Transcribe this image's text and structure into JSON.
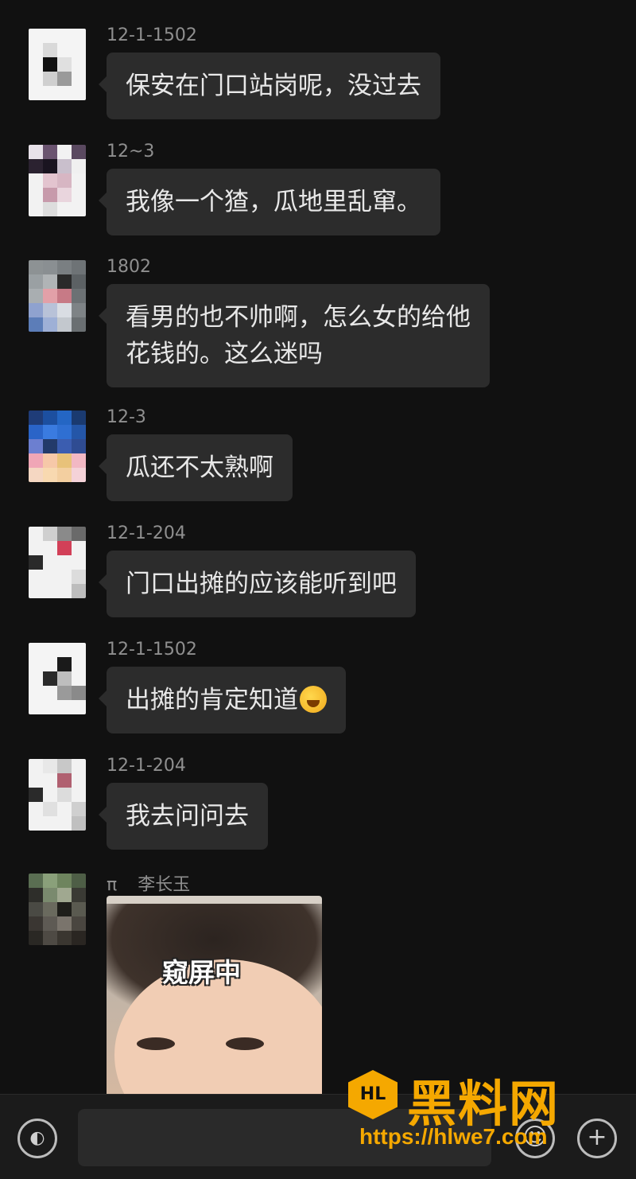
{
  "messages": [
    {
      "sender": "12-1-1502",
      "lines": [
        "保安在门口站岗呢，没过去"
      ]
    },
    {
      "sender": "12~3",
      "lines": [
        "我像一个猹，瓜地里乱窜。"
      ]
    },
    {
      "sender": "1802",
      "lines": [
        "看男的也不帅啊，怎么女的给他",
        "花钱的。这么迷吗"
      ]
    },
    {
      "sender": "12-3",
      "lines": [
        "瓜还不太熟啊"
      ]
    },
    {
      "sender": "12-1-204",
      "lines": [
        "门口出摊的应该能听到吧"
      ]
    },
    {
      "sender": "12-1-1502",
      "lines": [
        "出摊的肯定知道"
      ],
      "emoji": "laughing-crying-emoji"
    },
    {
      "sender": "12-1-204",
      "lines": [
        "我去问问去"
      ]
    },
    {
      "sender": "π",
      "sender_secondary": "李长玉",
      "sticker_caption": "窥屏中"
    }
  ],
  "input": {
    "value": "",
    "placeholder": ""
  },
  "toolbar": {
    "voice_icon": "voice-icon",
    "emoji_icon": "emoji-icon",
    "plus_icon": "plus-icon",
    "voice_glyph": "◐",
    "emoji_glyph": "☺",
    "plus_glyph": "+"
  },
  "watermark": {
    "logo_text": "HL",
    "brand": "黑料网",
    "url": "https://hlwe7.com"
  },
  "colors": {
    "background": "#111111",
    "bubble": "#2c2c2c",
    "sender_text": "#8f8f8f",
    "watermark": "#f5a800"
  }
}
